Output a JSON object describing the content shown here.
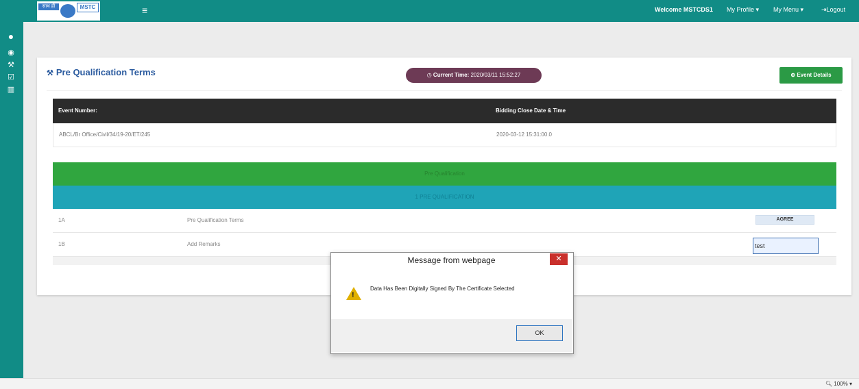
{
  "header": {
    "logo_text_left": "साथ हीं",
    "logo_text_right": "MSTC",
    "welcome": "Welcome MSTCDS1",
    "my_profile": "My Profile ▾",
    "my_menu": "My Menu ▾",
    "logout": "Logout"
  },
  "sidebar": {
    "icons": [
      "user-icon",
      "dashboard-icon",
      "gavel-icon",
      "check-icon",
      "chart-icon"
    ]
  },
  "page": {
    "title": "Pre Qualification Terms",
    "current_time_label": "Current Time:",
    "current_time_value": "2020/03/11 15:52:27",
    "event_details_button": "Event Details"
  },
  "event_table": {
    "col1_header": "Event Number:",
    "col2_header": "Bidding Close Date & Time",
    "event_number": "ABCL/Br Office/Civil/34/19-20/ET/245",
    "close_datetime": "2020-03-12 15:31:00.0"
  },
  "pq": {
    "section_header": "Pre Qualification",
    "sub_header": "1 PRE QUALIFICATION",
    "rows": [
      {
        "id": "1A",
        "label": "Pre Qualification Terms",
        "action": "AGREE"
      },
      {
        "id": "1B",
        "label": "Add Remarks",
        "value": "test"
      }
    ]
  },
  "dialog": {
    "title": "Message from webpage",
    "message": "Data Has Been Digitally Signed By The Certificate Selected",
    "ok": "OK"
  },
  "status": {
    "zoom": "100%"
  }
}
